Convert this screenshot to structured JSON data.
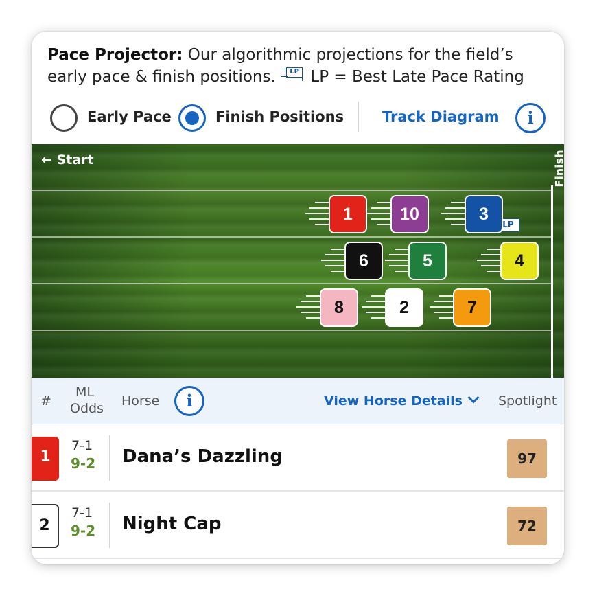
{
  "header": {
    "title": "Pace Projector:",
    "description": "Our algorithmic projections for the field’s early pace & finish positions.",
    "lp_icon_text": "LP",
    "lp_legend": "LP = Best Late Pace Rating"
  },
  "toggle": {
    "early_pace_label": "Early Pace",
    "finish_positions_label": "Finish Positions",
    "selected": "Finish Positions",
    "track_diagram_label": "Track Diagram",
    "info_icon": "info-icon"
  },
  "track": {
    "start_label": "← Start",
    "finish_label": "Finish",
    "lp_badge": "LP",
    "horses": [
      {
        "number": "1",
        "bg": "#e2231a",
        "fg": "#ffffff"
      },
      {
        "number": "10",
        "bg": "#8e3d94",
        "fg": "#ffffff"
      },
      {
        "number": "3",
        "bg": "#1452a6",
        "fg": "#ffffff"
      },
      {
        "number": "6",
        "bg": "#111111",
        "fg": "#ffffff"
      },
      {
        "number": "5",
        "bg": "#1f7f3c",
        "fg": "#ffffff"
      },
      {
        "number": "4",
        "bg": "#e5e51a",
        "fg": "#111111"
      },
      {
        "number": "8",
        "bg": "#f4b7c1",
        "fg": "#111111"
      },
      {
        "number": "2",
        "bg": "#ffffff",
        "fg": "#111111"
      },
      {
        "number": "7",
        "bg": "#f39a0e",
        "fg": "#111111"
      }
    ]
  },
  "table": {
    "headers": {
      "number": "#",
      "ml_odds_line1": "ML",
      "ml_odds_line2": "Odds",
      "horse": "Horse",
      "view_details": "View Horse Details",
      "spotlight": "Spotlight"
    },
    "rows": [
      {
        "pp": "1",
        "pp_bg": "#e2231a",
        "pp_fg": "#ffffff",
        "ml_odds": "7-1",
        "live_odds": "9-2",
        "name": "Dana’s Dazzling",
        "spotlight": "97"
      },
      {
        "pp": "2",
        "pp_bg": "#ffffff",
        "pp_fg": "#111111",
        "ml_odds": "7-1",
        "live_odds": "9-2",
        "name": "Night Cap",
        "spotlight": "72"
      }
    ]
  }
}
